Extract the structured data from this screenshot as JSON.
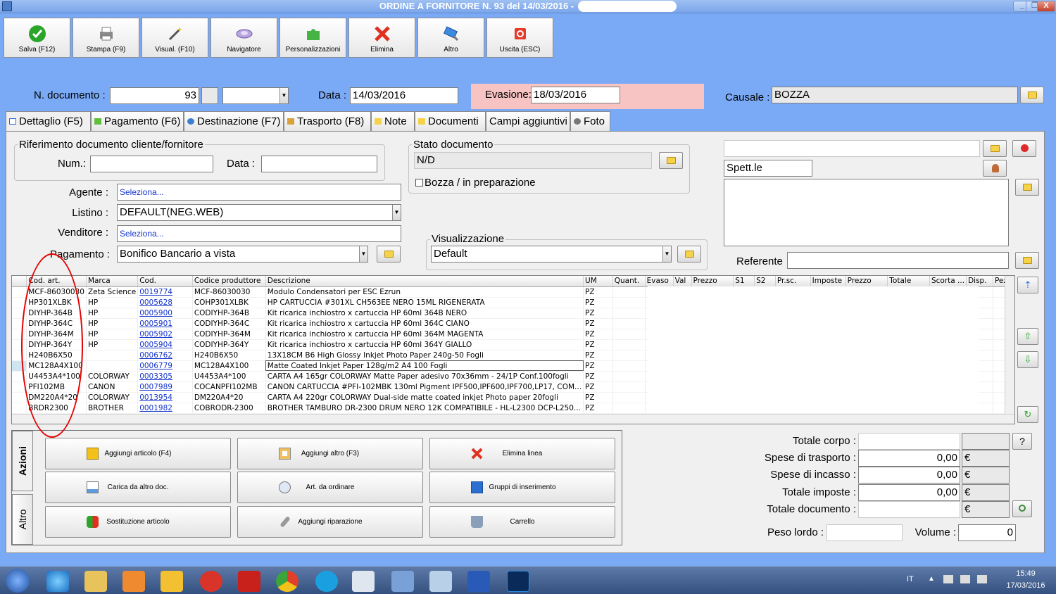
{
  "window": {
    "title": "ORDINE A FORNITORE N. 93 del 14/03/2016 -",
    "minimize": "_",
    "restore": "❐",
    "close": "X"
  },
  "toolbar": [
    {
      "label": "Salva (F12)",
      "icon": "check-icon"
    },
    {
      "label": "Stampa (F9)",
      "icon": "printer-icon"
    },
    {
      "label": "Visual. (F10)",
      "icon": "magic-wand-icon"
    },
    {
      "label": "Navigatore",
      "icon": "navigator-icon"
    },
    {
      "label": "Personalizzazioni",
      "icon": "puzzle-icon"
    },
    {
      "label": "Elimina",
      "icon": "delete-x-icon"
    },
    {
      "label": "Altro",
      "icon": "tools-icon"
    },
    {
      "label": "Uscita (ESC)",
      "icon": "exit-icon"
    }
  ],
  "header": {
    "ndoc_label": "N. documento :",
    "ndoc_value": "93",
    "data_label": "Data :",
    "data_value": "14/03/2016",
    "evasione_label": "Evasione:",
    "evasione_value": "18/03/2016",
    "causale_label": "Causale :",
    "causale_value": "BOZZA"
  },
  "tabs": [
    "Dettaglio (F5)",
    "Pagamento (F6)",
    "Destinazione (F7)",
    "Trasporto (F8)",
    "Note",
    "Documenti",
    "Campi aggiuntivi",
    "Foto"
  ],
  "rif": {
    "title": "Riferimento documento cliente/fornitore",
    "num_label": "Num.:",
    "data_label": "Data :"
  },
  "stato": {
    "title": "Stato documento",
    "value": "N/D",
    "bozza_label": "Bozza / in preparazione"
  },
  "form": {
    "agente_label": "Agente :",
    "agente_value": "Seleziona...",
    "listino_label": "Listino :",
    "listino_value": "DEFAULT(NEG.WEB)",
    "venditore_label": "Venditore :",
    "venditore_value": "Seleziona...",
    "pagamento_label": "Pagamento :",
    "pagamento_value": "Bonifico Bancario a vista",
    "visualizzazione_title": "Visualizzazione",
    "visualizzazione_value": "Default"
  },
  "supplier": {
    "spett": "Spett.le",
    "referente_label": "Referente"
  },
  "grid": {
    "columns": [
      "",
      "Cod. art.",
      "Marca",
      "Cod.",
      "Codice produttore",
      "Descrizione",
      "UM",
      "Quant.",
      "Evaso",
      "Val",
      "Prezzo",
      "S1",
      "S2",
      "Pr.sc.",
      "Imposte",
      "Prezzo",
      "Totale",
      "Scorta ...",
      "Disp.",
      "Pez"
    ],
    "rows": [
      {
        "art": "MCF-86030030",
        "marca": "Zeta Science",
        "cod": "0019774",
        "prod": "MCF-86030030",
        "desc": "Modulo Condensatori per ESC Ezrun",
        "um": "PZ",
        "val": "€"
      },
      {
        "art": "HP301XLBK",
        "marca": "HP",
        "cod": "0005628",
        "prod": "COHP301XLBK",
        "desc": "HP CARTUCCIA #301XL CH563EE NERO 15ML RIGENERATA",
        "um": "PZ",
        "val": "€"
      },
      {
        "art": "DIYHP-364B",
        "marca": "HP",
        "cod": "0005900",
        "prod": "CODIYHP-364B",
        "desc": "Kit ricarica inchiostro x cartuccia HP 60ml 364B NERO",
        "um": "PZ",
        "val": "€"
      },
      {
        "art": "DIYHP-364C",
        "marca": "HP",
        "cod": "0005901",
        "prod": "CODIYHP-364C",
        "desc": "Kit ricarica inchiostro x cartuccia HP 60ml 364C CIANO",
        "um": "PZ",
        "val": "€"
      },
      {
        "art": "DIYHP-364M",
        "marca": "HP",
        "cod": "0005902",
        "prod": "CODIYHP-364M",
        "desc": "Kit ricarica inchiostro x cartuccia HP 60ml 364M MAGENTA",
        "um": "PZ",
        "val": "€"
      },
      {
        "art": "DIYHP-364Y",
        "marca": "HP",
        "cod": "0005904",
        "prod": "CODIYHP-364Y",
        "desc": "Kit ricarica inchiostro x cartuccia HP 60ml 364Y GIALLO",
        "um": "PZ",
        "val": "€"
      },
      {
        "art": "H240B6X50",
        "marca": "",
        "cod": "0006762",
        "prod": "H240B6X50",
        "desc": "13X18CM B6 High Glossy Inkjet Photo Paper 240g-50 Fogli",
        "um": "PZ",
        "val": "€"
      },
      {
        "art": "MC128A4X100",
        "marca": "",
        "cod": "0006779",
        "prod": "MC128A4X100",
        "desc": "Matte Coated Inkjet Paper 128g/m2  A4 100 Fogli",
        "um": "PZ",
        "val": "€"
      },
      {
        "art": "U4453A4*100",
        "marca": "COLORWAY",
        "cod": "0003305",
        "prod": "U4453A4*100",
        "desc": "CARTA A4 165gr COLORWAY Matte Paper adesivo 70x36mm - 24/1P Conf.100fogli",
        "um": "PZ",
        "val": "€"
      },
      {
        "art": "PFI102MB",
        "marca": "CANON",
        "cod": "0007989",
        "prod": "COCANPFI102MB",
        "desc": "CANON CARTUCCIA #PFI-102MBK 130ml Pigment IPF500,IPF600,IPF700,LP17, COM...",
        "um": "PZ",
        "val": "€"
      },
      {
        "art": "DM220A4*20",
        "marca": "COLORWAY",
        "cod": "0013954",
        "prod": "DM220A4*20",
        "desc": "CARTA A4 220gr COLORWAY Dual-side matte coated inkjet Photo paper 20fogli",
        "um": "PZ",
        "val": "€"
      },
      {
        "art": "BRDR2300",
        "marca": "BROTHER",
        "cod": "0001982",
        "prod": "COBRODR-2300",
        "desc": "BROTHER TAMBURO DR-2300 DRUM NERO 12K COMPATIBILE - HL-L2300 DCP-L250...",
        "um": "PZ",
        "val": "€"
      }
    ]
  },
  "actions": {
    "tab_azioni": "Azioni",
    "tab_altro": "Altro",
    "buttons": [
      "Aggiungi articolo (F4)",
      "Aggiungi altro (F3)",
      "Elimina linea",
      "Carica da altro doc.",
      "Art. da ordinare",
      "Gruppi di inserimento",
      "Sostituzione articolo",
      "Aggiungi riparazione",
      "Carrello"
    ]
  },
  "totals": {
    "totale_corpo_label": "Totale corpo :",
    "spese_trasporto_label": "Spese di trasporto :",
    "spese_trasporto_value": "0,00",
    "spese_incasso_label": "Spese di incasso :",
    "spese_incasso_value": "0,00",
    "totale_imposte_label": "Totale imposte :",
    "totale_imposte_value": "0,00",
    "totale_documento_label": "Totale documento :",
    "currency": "€",
    "peso_label": "Peso lordo :",
    "volume_label": "Volume :",
    "volume_value": "0",
    "help": "?"
  },
  "taskbar": {
    "lang": "IT",
    "time": "15:49",
    "date": "17/03/2016"
  },
  "colors": {
    "background": "#7aaaf6",
    "evasione_bg": "#f7c3c3",
    "link": "#1535cc",
    "annotation": "#e40000"
  }
}
